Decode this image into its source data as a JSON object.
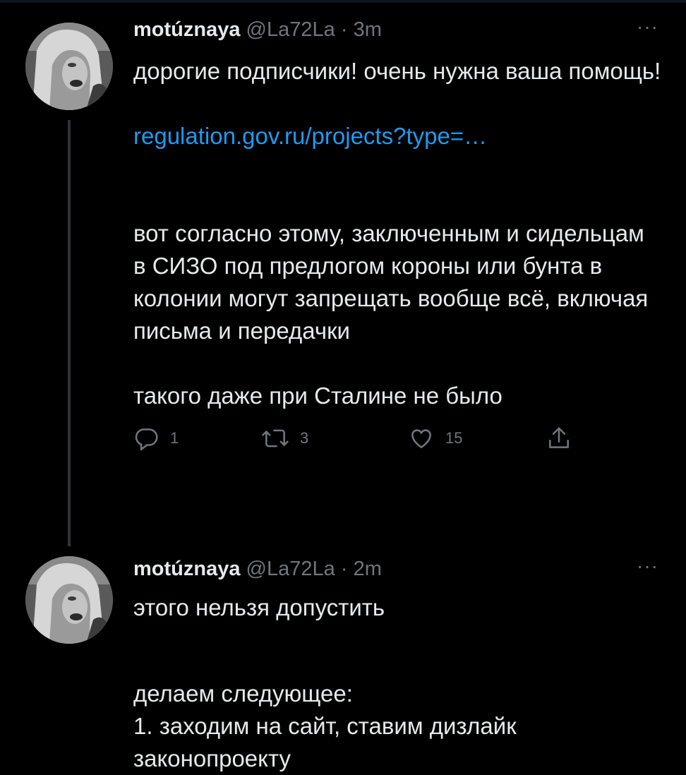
{
  "tweets": [
    {
      "author_name": "motúznaya",
      "handle": "@La72La",
      "separator": "·",
      "time": "3m",
      "more_label": "···",
      "paragraphs": [
        "дорогие подписчики! очень нужна ваша помощь!",
        "",
        "regulation.gov.ru/projects?type=…",
        "",
        "вот согласно этому, заключенным и сидельцам в СИЗО под предлогом короны или бунта в колонии могут запрещать вообще всё, включая письма и передачки",
        "",
        "такого даже при Сталине не было"
      ],
      "link": "regulation.gov.ru/projects?type=…",
      "actions": {
        "reply_count": "1",
        "retweet_count": "3",
        "like_count": "15"
      }
    },
    {
      "author_name": "motúznaya",
      "handle": "@La72La",
      "separator": "·",
      "time": "2m",
      "more_label": "···",
      "paragraphs": [
        "этого нельзя допустить",
        "",
        "делаем следующее:",
        "1. заходим на сайт, ставим дизлайк законопроекту"
      ]
    }
  ],
  "icons": {
    "reply": "reply-icon",
    "retweet": "retweet-icon",
    "like": "heart-icon",
    "share": "share-icon",
    "more": "more-icon"
  },
  "colors": {
    "background": "#000000",
    "text": "#e7e9ea",
    "secondary": "#71767b",
    "link": "#1d9bf0",
    "thread_line": "#2f3336"
  }
}
